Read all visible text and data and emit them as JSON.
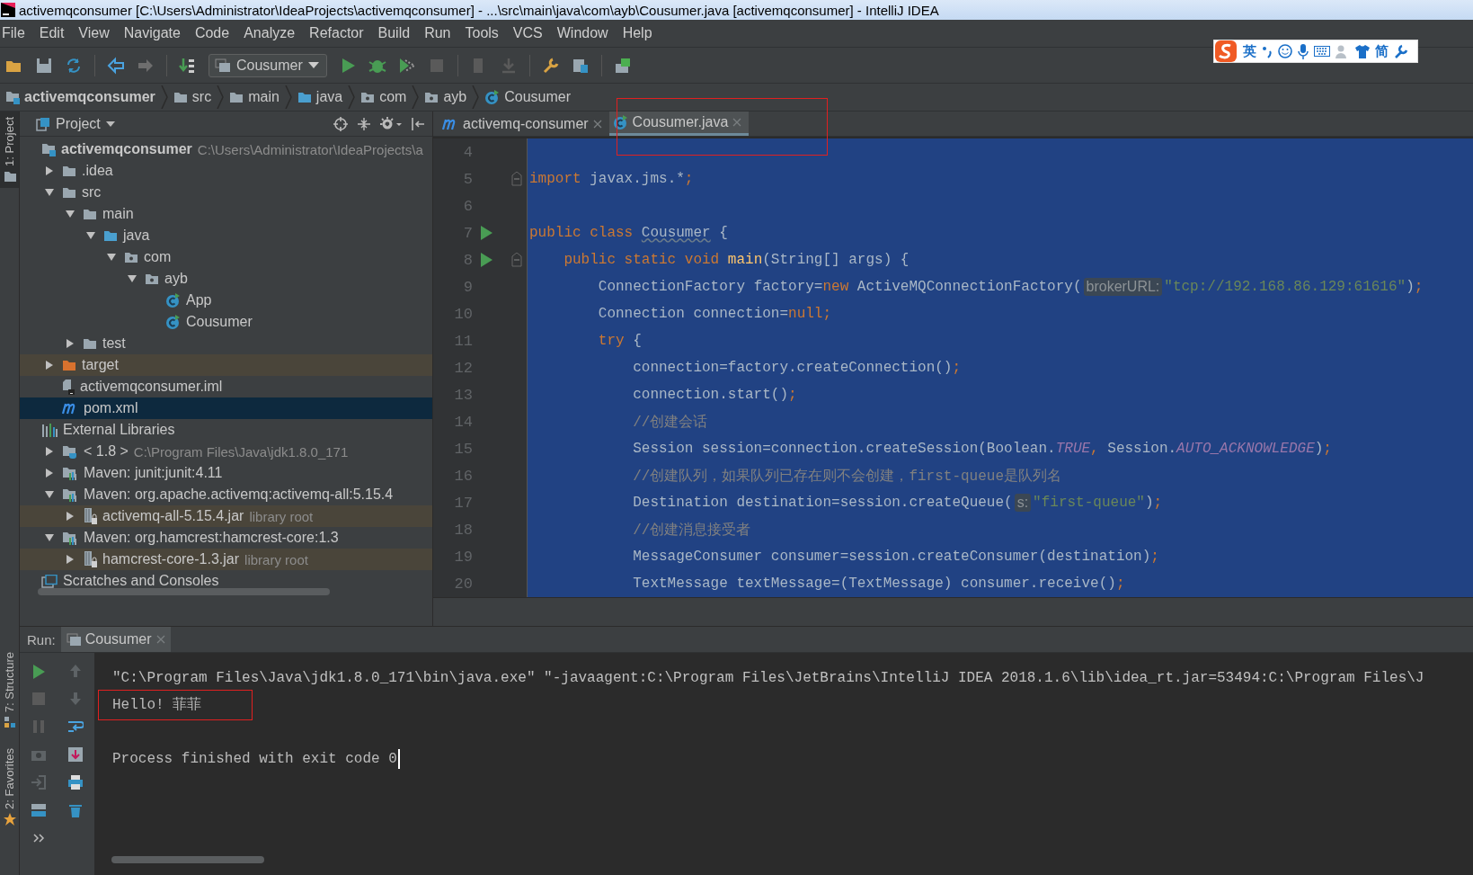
{
  "window": {
    "title": "activemqconsumer [C:\\Users\\Administrator\\IdeaProjects\\activemqconsumer] - ...\\src\\main\\java\\com\\ayb\\Cousumer.java [activemqconsumer] - IntelliJ IDEA"
  },
  "menu": [
    "File",
    "Edit",
    "View",
    "Navigate",
    "Code",
    "Analyze",
    "Refactor",
    "Build",
    "Run",
    "Tools",
    "VCS",
    "Window",
    "Help"
  ],
  "ime_bar": {
    "mode": "英",
    "script": "简"
  },
  "toolbar": {
    "run_config": "Cousumer"
  },
  "breadcrumbs": [
    {
      "label": "activemqconsumer",
      "kind": "project"
    },
    {
      "label": "src",
      "kind": "folder"
    },
    {
      "label": "main",
      "kind": "folder"
    },
    {
      "label": "java",
      "kind": "source_folder"
    },
    {
      "label": "com",
      "kind": "package"
    },
    {
      "label": "ayb",
      "kind": "package"
    },
    {
      "label": "Cousumer",
      "kind": "class"
    }
  ],
  "side_tabs": [
    {
      "label": "1: Project",
      "kind": "project",
      "selected": true
    },
    {
      "label": "7: Structure",
      "kind": "structure",
      "selected": false
    },
    {
      "label": "2: Favorites",
      "kind": "favorites",
      "selected": false
    }
  ],
  "project": {
    "title": "Project",
    "tree": [
      {
        "label": "activemqconsumer",
        "hint": "C:\\Users\\Administrator\\IdeaProjects\\a",
        "kind": "project",
        "selected": false,
        "highlighted": false,
        "children": [
          {
            "label": ".idea",
            "kind": "folder",
            "expanded": false,
            "selected": false,
            "highlighted": false
          },
          {
            "label": "src",
            "kind": "folder",
            "expanded": true,
            "selected": false,
            "highlighted": false,
            "children": [
              {
                "label": "main",
                "kind": "folder",
                "expanded": true,
                "selected": false,
                "highlighted": false,
                "children": [
                  {
                    "label": "java",
                    "kind": "source_folder",
                    "expanded": true,
                    "selected": false,
                    "highlighted": false,
                    "children": [
                      {
                        "label": "com",
                        "kind": "package",
                        "expanded": true,
                        "selected": false,
                        "highlighted": false,
                        "children": [
                          {
                            "label": "ayb",
                            "kind": "package",
                            "expanded": true,
                            "selected": false,
                            "highlighted": false,
                            "children": [
                              {
                                "label": "App",
                                "kind": "class",
                                "selected": false,
                                "highlighted": false
                              },
                              {
                                "label": "Cousumer",
                                "kind": "class",
                                "selected": false,
                                "highlighted": false
                              }
                            ]
                          }
                        ]
                      }
                    ]
                  }
                ]
              },
              {
                "label": "test",
                "kind": "folder",
                "expanded": false,
                "selected": false,
                "highlighted": false
              }
            ]
          },
          {
            "label": "target",
            "kind": "excluded_folder",
            "expanded": false,
            "selected": false,
            "highlighted": true
          },
          {
            "label": "activemqconsumer.iml",
            "kind": "module_file",
            "selected": false,
            "highlighted": false
          },
          {
            "label": "pom.xml",
            "kind": "maven_file",
            "selected": true,
            "highlighted": false
          }
        ]
      },
      {
        "label": "External Libraries",
        "kind": "libraries",
        "selected": false,
        "highlighted": false,
        "children": [
          {
            "label": "< 1.8 >",
            "hint": "C:\\Program Files\\Java\\jdk1.8.0_171",
            "kind": "jdk",
            "expanded": false,
            "selected": false,
            "highlighted": false
          },
          {
            "label": "Maven: junit:junit:4.11",
            "kind": "maven_library",
            "expanded": false,
            "selected": false,
            "highlighted": false
          },
          {
            "label": "Maven: org.apache.activemq:activemq-all:5.15.4",
            "kind": "maven_library",
            "expanded": true,
            "selected": false,
            "highlighted": false,
            "children": [
              {
                "label": "activemq-all-5.15.4.jar",
                "hint": "library root",
                "kind": "jar",
                "expanded": false,
                "selected": false,
                "highlighted": true
              }
            ]
          },
          {
            "label": "Maven: org.hamcrest:hamcrest-core:1.3",
            "kind": "maven_library",
            "expanded": true,
            "selected": false,
            "highlighted": false,
            "children": [
              {
                "label": "hamcrest-core-1.3.jar",
                "hint": "library root",
                "kind": "jar",
                "expanded": false,
                "selected": false,
                "highlighted": true
              }
            ]
          }
        ]
      },
      {
        "label": "Scratches and Consoles",
        "kind": "scratches",
        "selected": false,
        "highlighted": false
      }
    ]
  },
  "editor": {
    "tabs": [
      {
        "label": "activemq-consumer",
        "kind": "maven_file",
        "selected": false,
        "annotated": false
      },
      {
        "label": "Cousumer.java",
        "kind": "class",
        "selected": true,
        "annotated": true
      }
    ],
    "lines": [
      {
        "number": "4",
        "run": false,
        "fold": false
      },
      {
        "number": "5",
        "run": false,
        "fold": true,
        "tokens": [
          {
            "text": "import",
            "kind": "keyword"
          },
          {
            "text": " javax.jms.*",
            "kind": "plain"
          },
          {
            "text": ";",
            "kind": "punct"
          }
        ]
      },
      {
        "number": "6",
        "run": false,
        "fold": false
      },
      {
        "number": "7",
        "run": true,
        "fold": false,
        "tokens": [
          {
            "text": "public class ",
            "kind": "keyword"
          },
          {
            "text": "Cousumer",
            "kind": "declaration"
          },
          {
            "text": " {",
            "kind": "plain"
          }
        ],
        "children": [
          {
            "number": "8",
            "run": true,
            "fold": true,
            "tokens": [
              {
                "text": "public static void ",
                "kind": "keyword"
              },
              {
                "text": "main",
                "kind": "method"
              },
              {
                "text": "(String[] args) {",
                "kind": "plain"
              }
            ],
            "children": [
              {
                "number": "9",
                "run": false,
                "fold": false,
                "tokens": [
                  {
                    "text": "ConnectionFactory factory=",
                    "kind": "plain"
                  },
                  {
                    "text": "new",
                    "kind": "keyword"
                  },
                  {
                    "text": " ActiveMQConnectionFactory(",
                    "kind": "plain"
                  },
                  {
                    "text": "brokerURL:",
                    "kind": "hint"
                  },
                  {
                    "text": "\"tcp://192.168.86.129:61616\"",
                    "kind": "string"
                  },
                  {
                    "text": ")",
                    "kind": "plain"
                  },
                  {
                    "text": ";",
                    "kind": "punct"
                  }
                ]
              },
              {
                "number": "10",
                "run": false,
                "fold": false,
                "tokens": [
                  {
                    "text": "Connection connection=",
                    "kind": "plain"
                  },
                  {
                    "text": "null",
                    "kind": "keyword"
                  },
                  {
                    "text": ";",
                    "kind": "punct"
                  }
                ]
              },
              {
                "number": "11",
                "run": false,
                "fold": false,
                "tokens": [
                  {
                    "text": "try",
                    "kind": "keyword"
                  },
                  {
                    "text": " {",
                    "kind": "plain"
                  }
                ],
                "children": [
                  {
                    "number": "12",
                    "run": false,
                    "fold": false,
                    "tokens": [
                      {
                        "text": "connection=factory.createConnection()",
                        "kind": "plain"
                      },
                      {
                        "text": ";",
                        "kind": "punct"
                      }
                    ]
                  },
                  {
                    "number": "13",
                    "run": false,
                    "fold": false,
                    "tokens": [
                      {
                        "text": "connection.start()",
                        "kind": "plain"
                      },
                      {
                        "text": ";",
                        "kind": "punct"
                      }
                    ]
                  },
                  {
                    "number": "14",
                    "run": false,
                    "fold": false,
                    "tokens": [
                      {
                        "text": "//创建会话",
                        "kind": "comment"
                      }
                    ]
                  },
                  {
                    "number": "15",
                    "run": false,
                    "fold": false,
                    "tokens": [
                      {
                        "text": "Session session=connection.createSession(Boolean.",
                        "kind": "plain"
                      },
                      {
                        "text": "TRUE",
                        "kind": "constant"
                      },
                      {
                        "text": ",",
                        "kind": "punct"
                      },
                      {
                        "text": " Session.",
                        "kind": "plain"
                      },
                      {
                        "text": "AUTO_ACKNOWLEDGE",
                        "kind": "constant"
                      },
                      {
                        "text": ")",
                        "kind": "plain"
                      },
                      {
                        "text": ";",
                        "kind": "punct"
                      }
                    ]
                  },
                  {
                    "number": "16",
                    "run": false,
                    "fold": false,
                    "tokens": [
                      {
                        "text": "//创建队列，如果队列已存在则不会创建，first-queue是队列名",
                        "kind": "comment"
                      }
                    ]
                  },
                  {
                    "number": "17",
                    "run": false,
                    "fold": false,
                    "tokens": [
                      {
                        "text": "Destination destination=session.createQueue(",
                        "kind": "plain"
                      },
                      {
                        "text": "s:",
                        "kind": "hint"
                      },
                      {
                        "text": "\"first-queue\"",
                        "kind": "string"
                      },
                      {
                        "text": ")",
                        "kind": "plain"
                      },
                      {
                        "text": ";",
                        "kind": "punct"
                      }
                    ]
                  },
                  {
                    "number": "18",
                    "run": false,
                    "fold": false,
                    "tokens": [
                      {
                        "text": "//创建消息接受者",
                        "kind": "comment"
                      }
                    ]
                  },
                  {
                    "number": "19",
                    "run": false,
                    "fold": false,
                    "tokens": [
                      {
                        "text": "MessageConsumer consumer=session.createConsumer(destination)",
                        "kind": "plain"
                      },
                      {
                        "text": ";",
                        "kind": "punct"
                      }
                    ]
                  },
                  {
                    "number": "20",
                    "run": false,
                    "fold": false,
                    "tokens": [
                      {
                        "text": "TextMessage textMessage=(TextMessage) consumer.receive()",
                        "kind": "plain"
                      },
                      {
                        "text": ";",
                        "kind": "punct"
                      }
                    ]
                  }
                ]
              }
            ]
          }
        ]
      }
    ]
  },
  "run": {
    "label": "Run:",
    "tab": "Cousumer",
    "console": [
      {
        "text": "\"C:\\Program Files\\Java\\jdk1.8.0_171\\bin\\java.exe\" \"-javaagent:C:\\Program Files\\JetBrains\\IntelliJ IDEA 2018.1.6\\lib\\idea_rt.jar=53494:C:\\Program Files\\J",
        "kind": "command",
        "annotated": false,
        "cursor": false
      },
      {
        "text": "Hello! 菲菲",
        "kind": "output",
        "annotated": true,
        "cursor": false
      },
      {
        "text": "Process finished with exit code 0",
        "kind": "status",
        "annotated": false,
        "cursor": true
      }
    ]
  }
}
